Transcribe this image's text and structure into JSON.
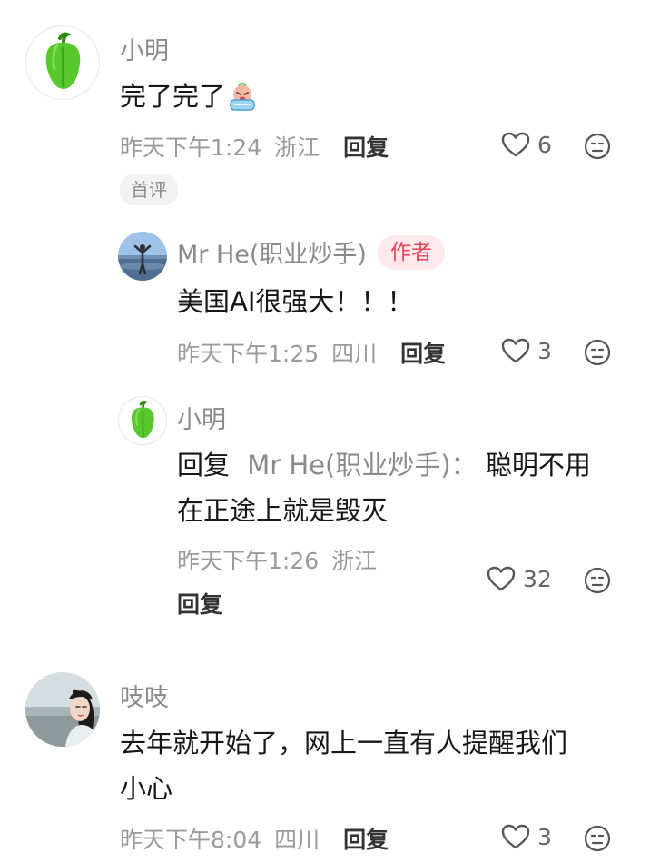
{
  "colors": {
    "name_gray": "#8a8a8a",
    "meta_gray": "#9a9a9a",
    "author_badge_bg": "#fde9ec",
    "author_badge_text": "#e8445a",
    "pepper_green": "#58c82f"
  },
  "comments": [
    {
      "username": "小明",
      "avatar_icon": "green-pepper-icon",
      "text": "完了完了",
      "emoji_icon": "crying-baby-emoji",
      "time": "昨天下午1:24",
      "location": "浙江",
      "reply_label": "回复",
      "likes": "6",
      "badge": "首评",
      "replies": [
        {
          "username": "Mr He(职业炒手)",
          "author_badge": "作者",
          "avatar_icon": "man-by-sea-photo",
          "text": "美国AI很强大！！！",
          "time": "昨天下午1:25",
          "location": "四川",
          "reply_label": "回复",
          "likes": "3"
        },
        {
          "username": "小明",
          "avatar_icon": "green-pepper-icon",
          "reply_prefix": "回复",
          "reply_target": "Mr He(职业炒手)：",
          "text_line1": "聪明不用",
          "text_line2": "在正途上就是毁灭",
          "time": "昨天下午1:26",
          "location": "浙江",
          "reply_label": "回复",
          "likes": "32"
        }
      ]
    },
    {
      "username": "吱吱",
      "avatar_icon": "woman-portrait-photo",
      "text_line1": "去年就开始了，网上一直有人提醒我们",
      "text_line2": "小心",
      "time": "昨天下午8:04",
      "location": "四川",
      "reply_label": "回复",
      "likes": "3"
    }
  ]
}
